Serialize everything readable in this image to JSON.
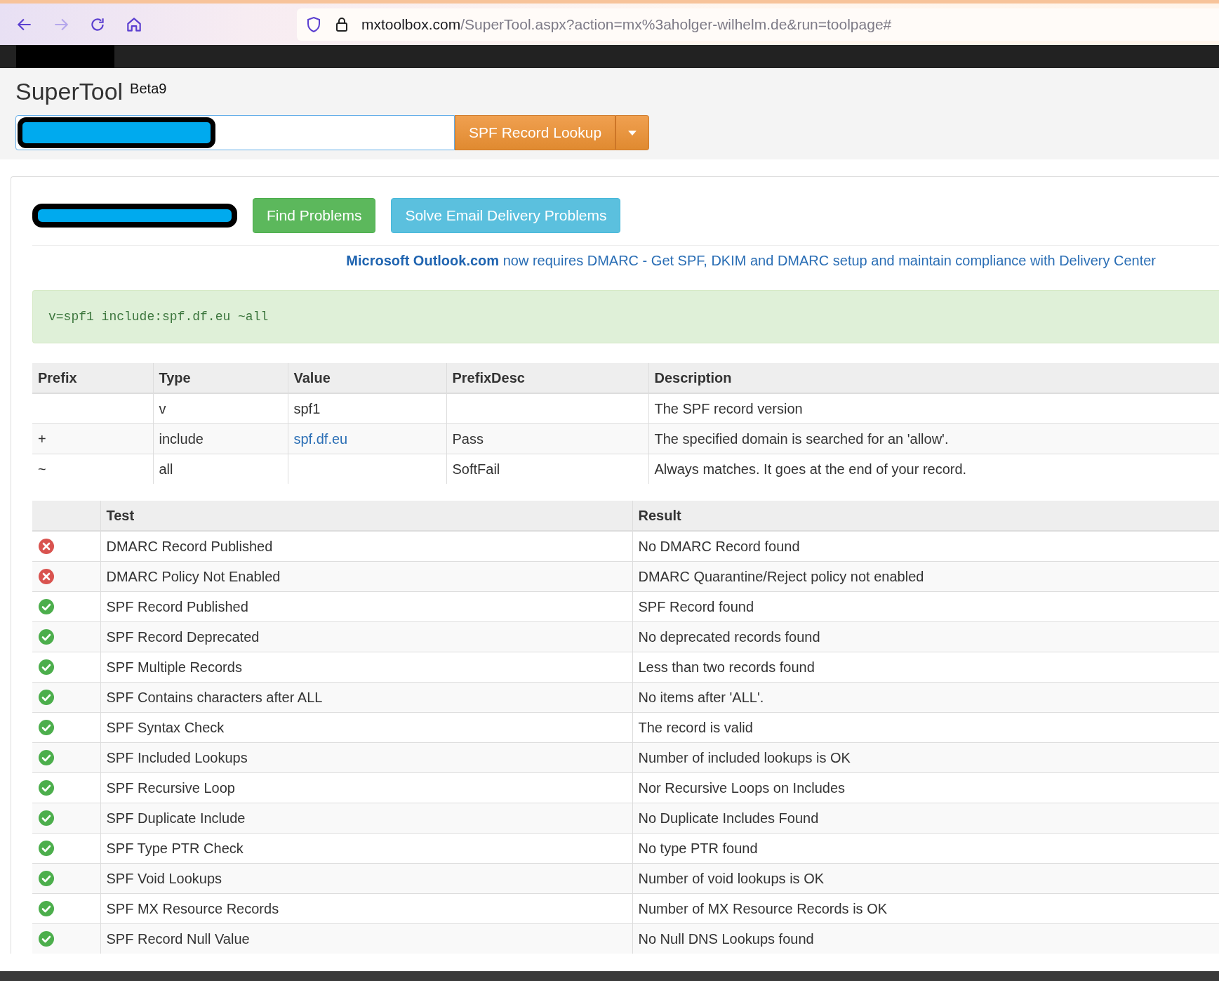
{
  "browser": {
    "url_host": "mxtoolbox.com",
    "url_path": "/SuperTool.aspx?action=mx%3aholger-wilhelm.de&run=toolpage#"
  },
  "header": {
    "title": "SuperTool",
    "badge": "Beta9",
    "lookup_button": "SPF Record Lookup"
  },
  "actions": [
    "Find Problems",
    "Solve Email Delivery Problems"
  ],
  "banner": {
    "link_bold": "Microsoft Outlook.com",
    "text": "now requires DMARC - Get SPF, DKIM and DMARC setup and maintain compliance with Delivery Center"
  },
  "spf_record": "v=spf1 include:spf.df.eu ~all",
  "record_table": {
    "columns": [
      "Prefix",
      "Type",
      "Value",
      "PrefixDesc",
      "Description"
    ],
    "rows": [
      {
        "prefix": "",
        "type": "v",
        "value": "spf1",
        "kind": "text",
        "prefix_desc": "",
        "description": "The SPF record version"
      },
      {
        "prefix": "+",
        "type": "include",
        "value": "spf.df.eu",
        "kind": "link",
        "prefix_desc": "Pass",
        "description": "The specified domain is searched for an 'allow'."
      },
      {
        "prefix": "~",
        "type": "all",
        "value": "",
        "kind": "text",
        "prefix_desc": "SoftFail",
        "description": "Always matches. It goes at the end of your record."
      }
    ]
  },
  "test_table": {
    "columns": [
      "Test",
      "Result"
    ],
    "rows": [
      {
        "kind": "fail",
        "test": "DMARC Record Published",
        "result": "No DMARC Record found"
      },
      {
        "kind": "fail",
        "test": "DMARC Policy Not Enabled",
        "result": "DMARC Quarantine/Reject policy not enabled"
      },
      {
        "kind": "pass",
        "test": "SPF Record Published",
        "result": "SPF Record found"
      },
      {
        "kind": "pass",
        "test": "SPF Record Deprecated",
        "result": "No deprecated records found"
      },
      {
        "kind": "pass",
        "test": "SPF Multiple Records",
        "result": "Less than two records found"
      },
      {
        "kind": "pass",
        "test": "SPF Contains characters after ALL",
        "result": "No items after 'ALL'."
      },
      {
        "kind": "pass",
        "test": "SPF Syntax Check",
        "result": "The record is valid"
      },
      {
        "kind": "pass",
        "test": "SPF Included Lookups",
        "result": "Number of included lookups is OK"
      },
      {
        "kind": "pass",
        "test": "SPF Recursive Loop",
        "result": "Nor Recursive Loops on Includes"
      },
      {
        "kind": "pass",
        "test": "SPF Duplicate Include",
        "result": "No Duplicate Includes Found"
      },
      {
        "kind": "pass",
        "test": "SPF Type PTR Check",
        "result": "No type PTR found"
      },
      {
        "kind": "pass",
        "test": "SPF Void Lookups",
        "result": "Number of void lookups is OK"
      },
      {
        "kind": "pass",
        "test": "SPF MX Resource Records",
        "result": "Number of MX Resource Records is OK"
      },
      {
        "kind": "pass",
        "test": "SPF Record Null Value",
        "result": "No Null DNS Lookups found"
      }
    ]
  }
}
